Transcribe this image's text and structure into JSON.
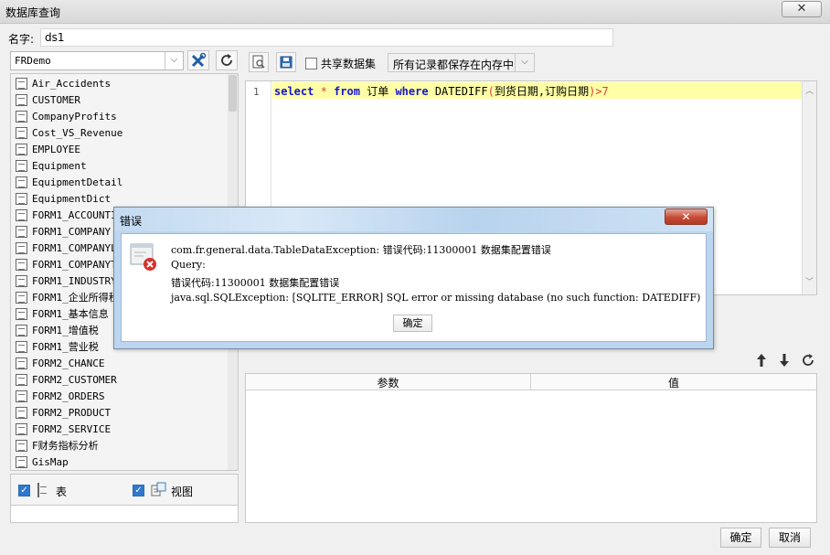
{
  "window": {
    "title": "数据库查询",
    "close_glyph": "✕"
  },
  "name_field": {
    "label": "名字:",
    "value": "ds1"
  },
  "left_panel": {
    "datasource": "FRDemo",
    "tables": [
      "Air_Accidents",
      "CUSTOMER",
      "CompanyProfits",
      "Cost_VS_Revenue",
      "EMPLOYEE",
      "Equipment",
      "EquipmentDetail",
      "EquipmentDict",
      "FORM1_ACCOUNTING",
      "FORM1_COMPANY",
      "FORM1_COMPANYLIST",
      "FORM1_COMPANYTYPE",
      "FORM1_INDUSTRY",
      "FORM1_企业所得税",
      "FORM1_基本信息",
      "FORM1_增值税",
      "FORM1_营业税",
      "FORM2_CHANCE",
      "FORM2_CUSTOMER",
      "FORM2_ORDERS",
      "FORM2_PRODUCT",
      "FORM2_SERVICE",
      "F财务指标分析",
      "GisMap"
    ],
    "filter_table_label": "表",
    "filter_view_label": "视图"
  },
  "toolbar": {
    "share_label": "共享数据集",
    "memory_option": "所有记录都保存在内存中"
  },
  "editor": {
    "line_number": "1",
    "sql": {
      "kw_select": "select",
      "star": "*",
      "kw_from": "from",
      "table": "订单",
      "kw_where": "where",
      "func": "DATEDIFF",
      "lparen": "(",
      "args": "到货日期,订购日期",
      "rparen": ")",
      "cmp": ">7"
    }
  },
  "params_table": {
    "columns": [
      "参数",
      "值"
    ]
  },
  "buttons": {
    "ok": "确定",
    "cancel": "取消"
  },
  "error_dialog": {
    "title": "错误",
    "close_glyph": "✕",
    "lines": [
      "com.fr.general.data.TableDataException: 错误代码:11300001 数据集配置错误",
      "Query:",
      "错误代码:11300001 数据集配置错误",
      "java.sql.SQLException: [SQLITE_ERROR] SQL error or missing database (no such function: DATEDIFF)"
    ],
    "ok": "确定"
  }
}
